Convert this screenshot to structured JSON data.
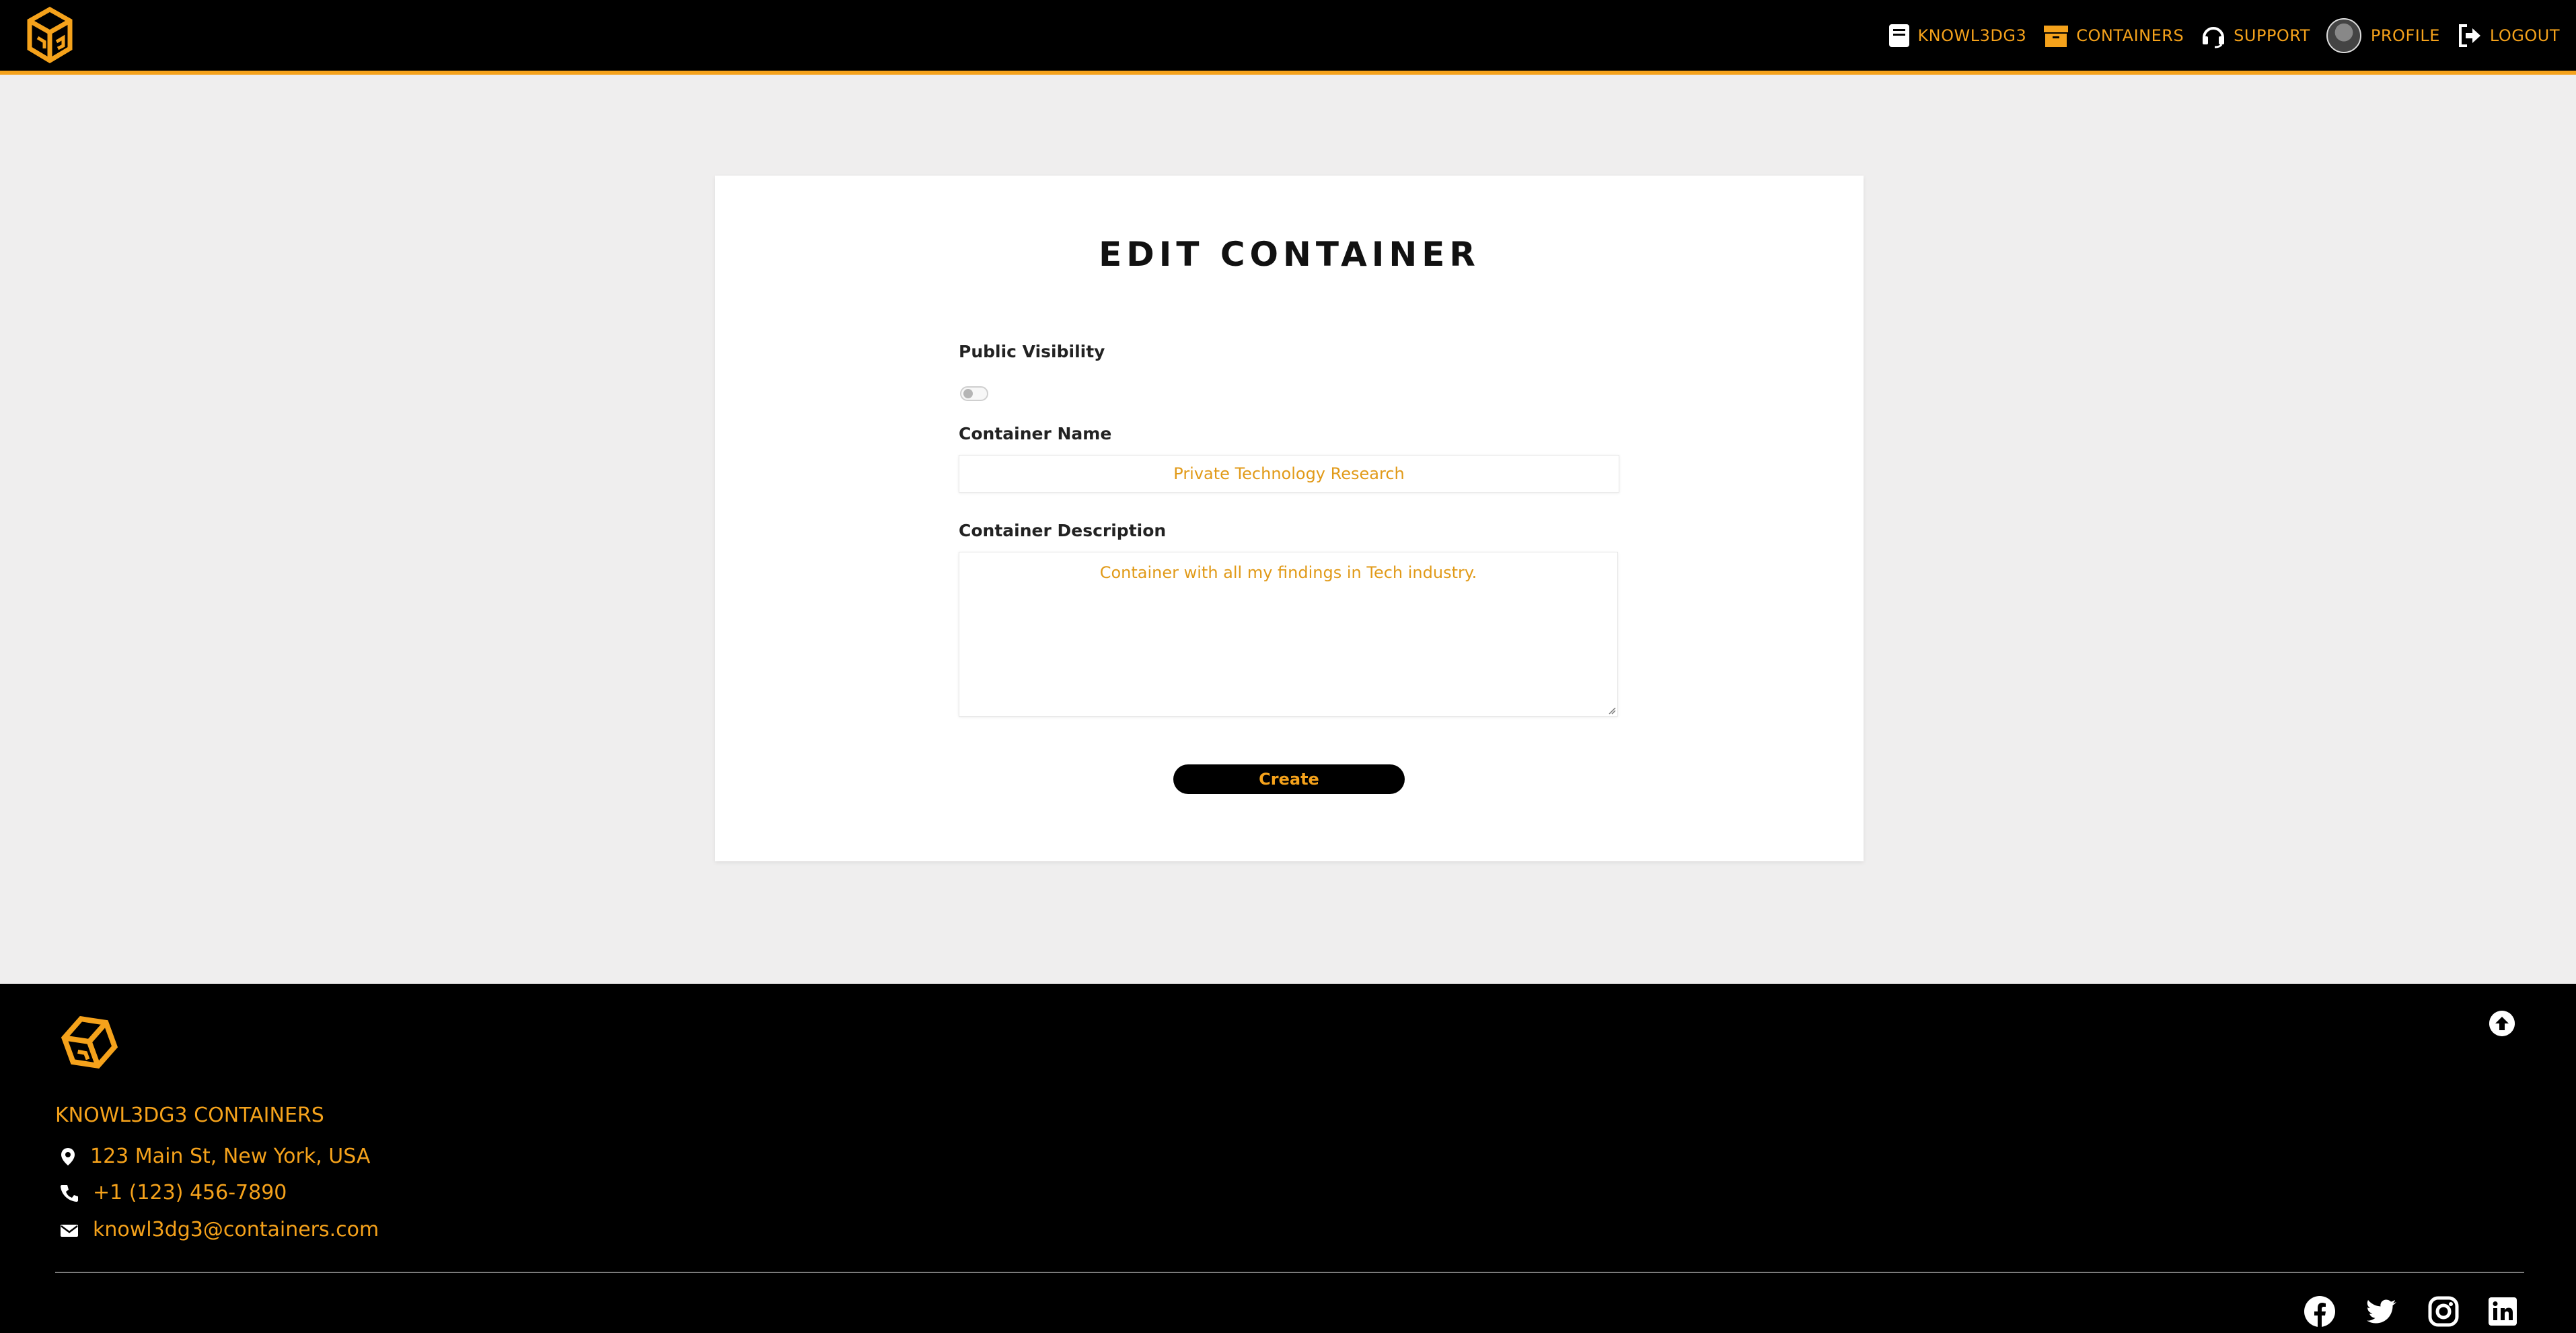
{
  "header": {
    "nav": [
      {
        "label": "KNOWL3DG3",
        "icon": "book-icon"
      },
      {
        "label": "CONTAINERS",
        "icon": "box-icon"
      },
      {
        "label": "SUPPORT",
        "icon": "headset-icon"
      },
      {
        "label": "PROFILE",
        "icon": "avatar"
      },
      {
        "label": "LOGOUT",
        "icon": "logout-icon"
      }
    ]
  },
  "form": {
    "title": "EDIT CONTAINER",
    "visibility_label": "Public Visibility",
    "visibility_on": false,
    "name_label": "Container Name",
    "name_value": "Private Technology Research",
    "description_label": "Container Description",
    "description_value": "Container with all my findings in Tech industry.",
    "submit_label": "Create"
  },
  "footer": {
    "company": "KNOWL3DG3 CONTAINERS",
    "address": "123 Main St, New York, USA",
    "phone": "+1 (123) 456-7890",
    "email": "knowl3dg3@containers.com",
    "social": [
      "facebook-icon",
      "twitter-icon",
      "instagram-icon",
      "linkedin-icon"
    ]
  },
  "colors": {
    "accent": "#f5a21b",
    "header_bg": "#000000",
    "page_bg": "#efeeee"
  }
}
